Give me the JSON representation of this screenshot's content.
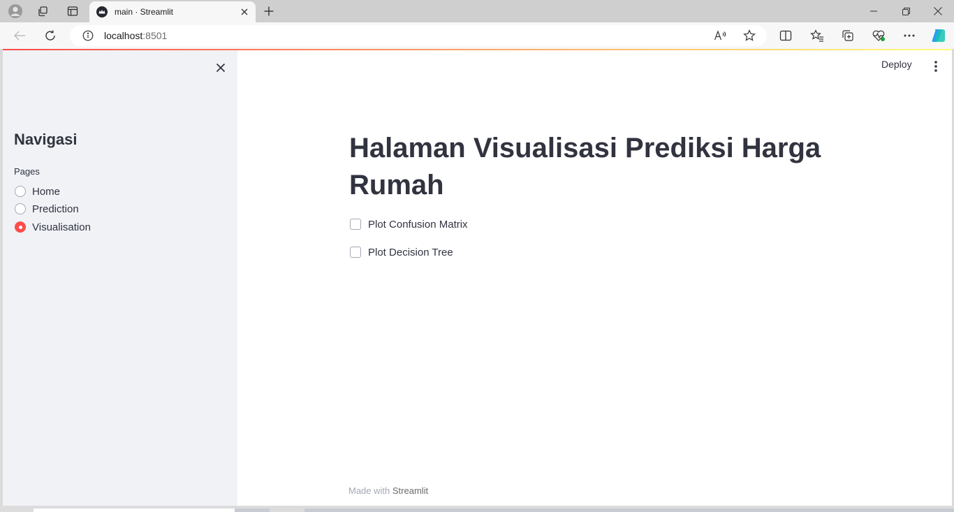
{
  "browser": {
    "tab": {
      "title": "main · Streamlit"
    },
    "address": {
      "host": "localhost",
      "port": ":8501"
    },
    "icons": {
      "profile": "profile-icon",
      "workspaces": "workspaces-icon",
      "tab_actions": "tab-actions-icon",
      "favicon": "streamlit-crown-icon",
      "new_tab": "plus-icon",
      "minimize": "minimize-icon",
      "restore": "restore-icon",
      "close": "close-icon",
      "back": "back-arrow-icon",
      "reload": "reload-icon",
      "site_info": "info-icon",
      "read_aloud": "read-aloud-icon",
      "favorite": "star-icon",
      "split_screen": "split-screen-icon",
      "favorites": "favorites-icon",
      "collections": "collections-icon",
      "browser_essentials": "heartbeat-icon",
      "more": "more-dots-icon",
      "copilot": "copilot-icon"
    }
  },
  "sidebar": {
    "title": "Navigasi",
    "radio_label": "Pages",
    "options": [
      {
        "label": "Home",
        "selected": false
      },
      {
        "label": "Prediction",
        "selected": false
      },
      {
        "label": "Visualisation",
        "selected": true
      }
    ]
  },
  "header": {
    "deploy_label": "Deploy"
  },
  "main": {
    "title": "Halaman Visualisasi Prediksi Harga Rumah",
    "checkboxes": [
      {
        "label": "Plot Confusion Matrix",
        "checked": false
      },
      {
        "label": "Plot Decision Tree",
        "checked": false
      }
    ]
  },
  "footer": {
    "prefix": "Made with ",
    "brand": "Streamlit"
  },
  "colors": {
    "accent": "#ff4b4b",
    "sidebar_bg": "#f0f2f6",
    "text": "#31333f",
    "muted": "#a3a8b4"
  }
}
